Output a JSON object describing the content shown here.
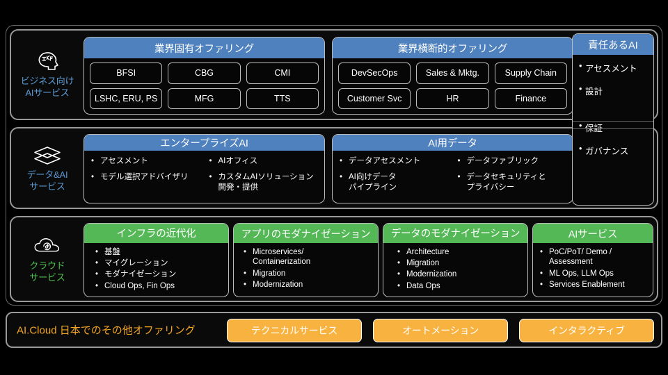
{
  "rows": [
    {
      "rail": {
        "icon": "brain-head-icon",
        "label": "ビジネス向け\nAIサービス",
        "color": "blue"
      },
      "cards": [
        {
          "title": "業界固有オファリング",
          "accent": "blue",
          "chips": [
            "BFSI",
            "CBG",
            "CMI",
            "LSHC, ERU, PS",
            "MFG",
            "TTS"
          ]
        },
        {
          "title": "業界横断的オファリング",
          "accent": "blue",
          "chips": [
            "DevSecOps",
            "Sales & Mktg.",
            "Supply Chain",
            "Customer Svc",
            "HR",
            "Finance"
          ]
        }
      ]
    },
    {
      "rail": {
        "icon": "layers-icon",
        "label": "データ&AI\nサービス",
        "color": "blue"
      },
      "cards": [
        {
          "title": "エンタープライズAI",
          "accent": "blue",
          "columns": [
            [
              "アセスメント",
              "モデル選択アドバイザリ"
            ],
            [
              "AIオフィス",
              "カスタムAIソリューション\n開発・提供"
            ]
          ]
        },
        {
          "title": "AI用データ",
          "accent": "blue",
          "columns": [
            [
              "データアセスメント",
              "AI向けデータ\nパイプライン"
            ],
            [
              "データファブリック",
              "データセキュリティと\nプライバシー"
            ]
          ]
        }
      ]
    },
    {
      "rail": {
        "icon": "cloud-sync-icon",
        "label": "クラウド\nサービス",
        "color": "green"
      },
      "cards": [
        {
          "title": "インフラの近代化",
          "accent": "green",
          "columns": [
            [
              "基盤",
              "マイグレーション",
              "モダナイゼーション",
              "Cloud Ops, Fin Ops"
            ]
          ]
        },
        {
          "title": "アプリのモダナイゼーション",
          "accent": "green",
          "columns": [
            [
              "Microservices/\nContainerization",
              "Migration",
              "Modernization"
            ]
          ]
        },
        {
          "title": "データのモダナイゼーション",
          "accent": "green",
          "columns": [
            [
              "Architecture",
              "Migration",
              "Modernization",
              "Data Ops"
            ]
          ]
        },
        {
          "title": "AIサービス",
          "accent": "green",
          "columns": [
            [
              "PoC/PoT/ Demo /\nAssessment",
              "ML Ops, LLM Ops",
              "Services Enablement"
            ]
          ]
        }
      ]
    }
  ],
  "responsible_ai": {
    "title": "責任あるAI",
    "items_top": [
      "アセスメント",
      "設計"
    ],
    "items_bottom": [
      "保証",
      "ガバナンス"
    ]
  },
  "bottom": {
    "title": "AI.Cloud 日本でのその他オファリング",
    "pills": [
      "テクニカルサービス",
      "オートメーション",
      "インタラクティブ"
    ]
  },
  "colors": {
    "accent_blue": "#4e81bd",
    "accent_green": "#55b857",
    "accent_orange": "#f8b23f",
    "rail_blue": "#5b9bd5",
    "rail_green": "#4fc04f",
    "background": "#000000",
    "border": "#bdbdbd"
  }
}
